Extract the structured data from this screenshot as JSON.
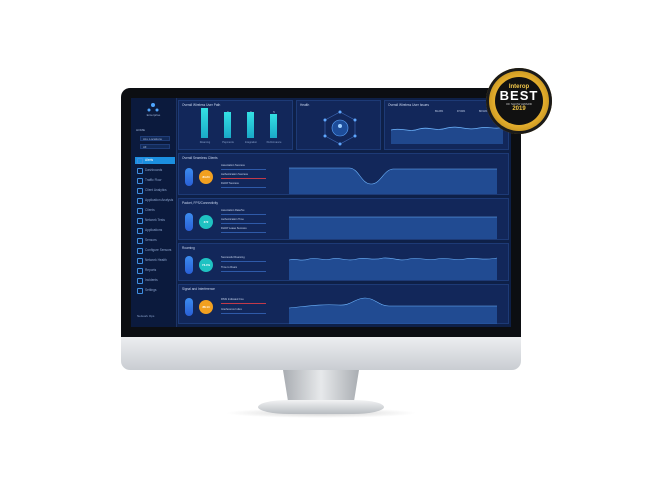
{
  "badge": {
    "brand": "Interop",
    "title": "BEST",
    "subtitle": "OF SHOW AWARD",
    "year": "2019"
  },
  "app": {
    "logo_text": "Enterprise",
    "user_label": "HOME",
    "dropdowns": [
      "ALL Locations",
      "All"
    ],
    "nav": [
      {
        "label": "Alerts",
        "active": true
      },
      {
        "label": "Dashboards",
        "active": false
      },
      {
        "label": "Traffic Flow",
        "active": false
      },
      {
        "label": "Client Analytics",
        "active": false
      },
      {
        "label": "Application Analysis",
        "active": false
      },
      {
        "label": "Clients",
        "active": false
      },
      {
        "label": "Network Tests",
        "active": false
      },
      {
        "label": "Applications",
        "active": false
      },
      {
        "label": "Sensors",
        "active": false
      },
      {
        "label": "Configure Sensors",
        "active": false
      },
      {
        "label": "Network Health",
        "active": false
      },
      {
        "label": "Reports",
        "active": false
      },
      {
        "label": "Incidents",
        "active": false
      },
      {
        "label": "Settings",
        "active": false
      }
    ],
    "nav_footer": "Network Ops"
  },
  "top_panels": {
    "bar_panel_title": "Overall Wireless User Path",
    "bars": [
      {
        "label": "Roaming",
        "value": "7"
      },
      {
        "label": "Payments",
        "value": "6"
      },
      {
        "label": "Integration",
        "value": "6"
      },
      {
        "label": "Performance",
        "value": "5"
      }
    ],
    "health_title": "Health",
    "trend_title": "Overall Wireless User Issues",
    "trend_stats": [
      "89.23%",
      "97.84%",
      "88.91%"
    ]
  },
  "sections": [
    {
      "title": "Overall Seamless Clients",
      "circle_value": "84.24",
      "circle_color": "o",
      "metrics": [
        "Association Success",
        "Authentication Success",
        "DHCP Success"
      ]
    },
    {
      "title": "Packet, FPS/Connectivity",
      "circle_value": "372",
      "circle_color": "t",
      "metrics": [
        "Association Rate/Su",
        "Authentication Time",
        "DHCP Lease Success"
      ]
    },
    {
      "title": "Roaming",
      "circle_value": "73.4%",
      "circle_color": "t",
      "metrics": [
        "Successful Roaming",
        "Time to Roam"
      ]
    },
    {
      "title": "Signal and Interference",
      "circle_value": "88.14",
      "circle_color": "o",
      "metrics": [
        "RSSI Indicated Cov.",
        "Interference Index"
      ]
    }
  ],
  "colors": {
    "screen_bg": "#0e2048",
    "panel_bg": "#12275a",
    "accent": "#1b8fe0",
    "bar": "#34e0e4",
    "orange": "#f2a020",
    "teal": "#1fc2c2"
  }
}
